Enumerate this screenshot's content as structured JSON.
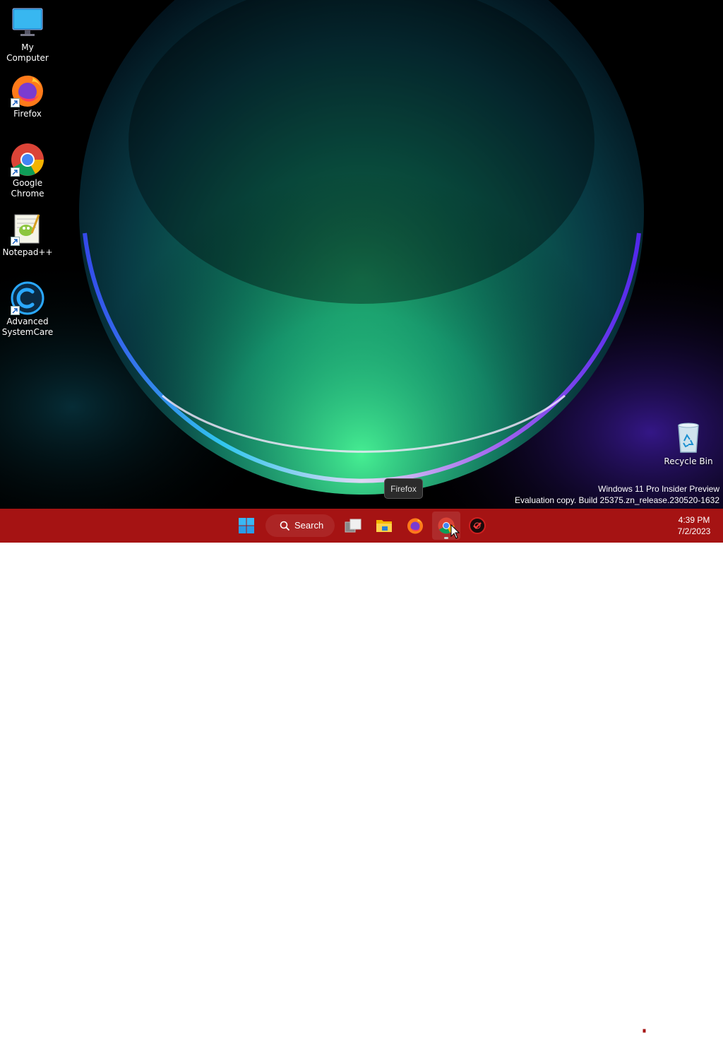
{
  "desktop": {
    "icons": [
      {
        "label": "My Computer"
      },
      {
        "label": "Firefox"
      },
      {
        "label": "Google Chrome"
      },
      {
        "label": "Notepad++"
      },
      {
        "label": "Advanced SystemCare"
      },
      {
        "label": "Recycle Bin"
      }
    ],
    "watermark": {
      "line1": "Windows 11 Pro Insider Preview",
      "line2": "Evaluation copy. Build 25375.zn_release.230520-1632"
    },
    "tooltip": "Firefox"
  },
  "taskbar": {
    "color": "#a51313",
    "search_label": "Search",
    "apps": [
      {
        "icon": "windows-start-icon"
      },
      {
        "icon": "search-icon"
      },
      {
        "icon": "task-view-icon"
      },
      {
        "icon": "file-explorer-icon"
      },
      {
        "icon": "firefox-icon"
      },
      {
        "icon": "chrome-icon"
      },
      {
        "icon": "advanced-systemcare-icon"
      }
    ],
    "tray": {
      "icons": [
        "chevron-up-icon",
        "onedrive-icon",
        "keyboard-icon",
        "network-icon",
        "volume-icon"
      ],
      "time": "4:39 PM",
      "date": "7/2/2023"
    }
  }
}
